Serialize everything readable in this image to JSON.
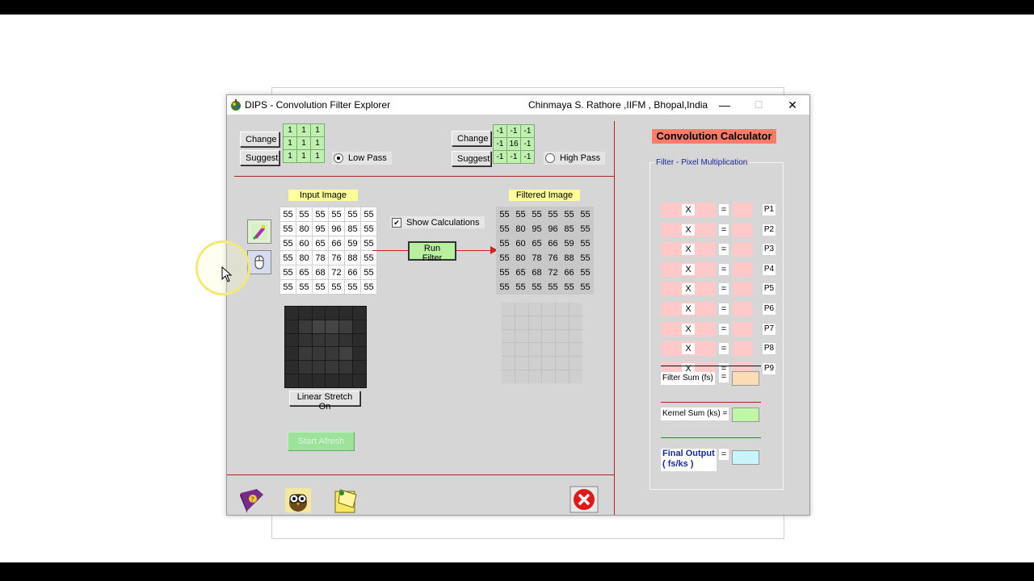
{
  "window": {
    "title": "DIPS - Convolution  Filter Explorer",
    "author": "Chinmaya S. Rathore ,IIFM , Bhopal,India",
    "controls": {
      "minimize": "—",
      "maximize": "☐",
      "close": "✕"
    }
  },
  "low_pass": {
    "change_label": "Change",
    "suggest_label": "Suggest",
    "kernel": [
      [
        "1",
        "1",
        "1"
      ],
      [
        "1",
        "1",
        "1"
      ],
      [
        "1",
        "1",
        "1"
      ]
    ],
    "radio_label": "Low Pass",
    "selected": true
  },
  "high_pass": {
    "change_label": "Change",
    "suggest_label": "Suggest",
    "kernel": [
      [
        "-1",
        "-1",
        "-1"
      ],
      [
        "-1",
        "16",
        "-1"
      ],
      [
        "-1",
        "-1",
        "-1"
      ]
    ],
    "radio_label": "High Pass",
    "selected": false
  },
  "input_image": {
    "label": "Input Image",
    "pixels": [
      [
        "55",
        "55",
        "55",
        "55",
        "55",
        "55"
      ],
      [
        "55",
        "80",
        "95",
        "96",
        "85",
        "55"
      ],
      [
        "55",
        "60",
        "65",
        "66",
        "59",
        "55"
      ],
      [
        "55",
        "80",
        "78",
        "76",
        "88",
        "55"
      ],
      [
        "55",
        "65",
        "68",
        "72",
        "66",
        "55"
      ],
      [
        "55",
        "55",
        "55",
        "55",
        "55",
        "55"
      ]
    ],
    "preview_gray": [
      [
        "#2b2b2b",
        "#2b2b2b",
        "#2b2b2b",
        "#2b2b2b",
        "#2b2b2b",
        "#2b2b2b"
      ],
      [
        "#2b2b2b",
        "#3a3a3a",
        "#444444",
        "#454545",
        "#3e3e3e",
        "#2b2b2b"
      ],
      [
        "#2b2b2b",
        "#333333",
        "#363636",
        "#373737",
        "#323232",
        "#2b2b2b"
      ],
      [
        "#2b2b2b",
        "#3a3a3a",
        "#393939",
        "#383838",
        "#404040",
        "#2b2b2b"
      ],
      [
        "#2b2b2b",
        "#353535",
        "#363636",
        "#383838",
        "#363636",
        "#2b2b2b"
      ],
      [
        "#2b2b2b",
        "#2b2b2b",
        "#2b2b2b",
        "#2b2b2b",
        "#2b2b2b",
        "#2b2b2b"
      ]
    ]
  },
  "show_calculations": {
    "label": "Show Calculations",
    "checked": true,
    "mark": "✔"
  },
  "run_filter_label": "Run Filter",
  "filtered_image": {
    "label": "Filtered Image",
    "pixels": [
      [
        "55",
        "55",
        "55",
        "55",
        "55",
        "55"
      ],
      [
        "55",
        "80",
        "95",
        "96",
        "85",
        "55"
      ],
      [
        "55",
        "60",
        "65",
        "66",
        "59",
        "55"
      ],
      [
        "55",
        "80",
        "78",
        "76",
        "88",
        "55"
      ],
      [
        "55",
        "65",
        "68",
        "72",
        "66",
        "55"
      ],
      [
        "55",
        "55",
        "55",
        "55",
        "55",
        "55"
      ]
    ]
  },
  "linear_stretch_label": "Linear Stretch On",
  "start_afresh_label": "Start Afresh",
  "calculator": {
    "title": "Convolution Calculator",
    "group_label": "Filter - Pixel Multiplication",
    "multiply_symbol": "X",
    "equals_symbol": "=",
    "rows": [
      "P1",
      "P2",
      "P3",
      "P4",
      "P5",
      "P6",
      "P7",
      "P8",
      "P9"
    ],
    "filter_sum_label": "Filter Sum (fs)",
    "kernel_sum_label": "Kernel Sum (ks) =",
    "final_output_label_1": "Final Output",
    "final_output_label_2": "( fs/ks )",
    "filter_sum_color": "#fcdcb4",
    "kernel_sum_color": "#bff7a6",
    "final_output_color": "#c8f4fb"
  },
  "icons": {
    "app": "dips-app-icon",
    "brush": "paintbrush-icon",
    "mouse": "mouse-icon",
    "help": "help-book-icon",
    "about": "owl-icon",
    "notes": "notepad-icon",
    "exit": "exit-icon"
  }
}
